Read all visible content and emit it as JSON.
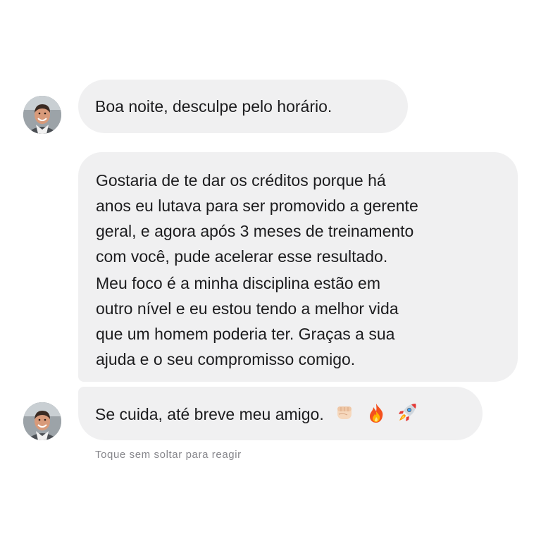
{
  "conversation": {
    "messages": [
      {
        "text": "Boa noite, desculpe pelo horário."
      },
      {
        "paragraphs": [
          "Gostaria de te dar os créditos porque há\nanos eu lutava para ser promovido a gerente\ngeral, e agora após 3 meses de treinamento\ncom você, pude acelerar esse resultado.",
          "Meu foco é a minha disciplina estão em\noutro nível e eu estou tendo a melhor vida\nque um homem poderia ter. Graças a sua\najuda e o seu compromisso comigo."
        ]
      },
      {
        "text": "Se cuida, até breve meu amigo.",
        "emojis": [
          "fist-emoji",
          "fire-emoji",
          "rocket-emoji"
        ]
      }
    ],
    "reaction_hint": "Toque sem soltar para reagir"
  },
  "colors": {
    "bubble_background": "#f0f0f1",
    "text": "#1c1c1e",
    "hint_text": "#86868b",
    "page_background": "#ffffff"
  }
}
